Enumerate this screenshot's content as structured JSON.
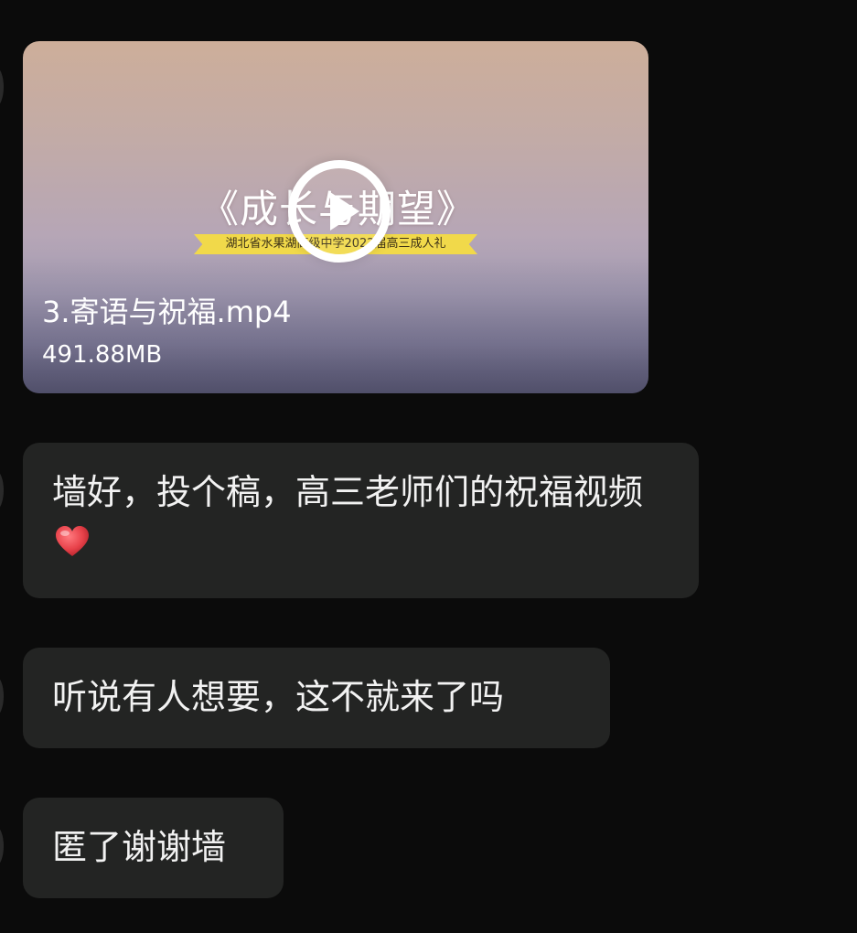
{
  "video": {
    "title": "《成长与期望》",
    "banner": "湖北省水果湖高级中学2022届高三成人礼",
    "file_name": "3.寄语与祝福.mp4",
    "file_size": "491.88MB"
  },
  "messages": [
    {
      "text": "墙好，投个稿，高三老师们的祝福视频",
      "emoji": "red-heart"
    },
    {
      "text": "听说有人想要，这不就来了吗"
    },
    {
      "text": "匿了谢谢墙"
    }
  ],
  "colors": {
    "background": "#0b0b0b",
    "bubble": "#232423",
    "banner": "#f1d94a",
    "heart": "#e8424a"
  }
}
